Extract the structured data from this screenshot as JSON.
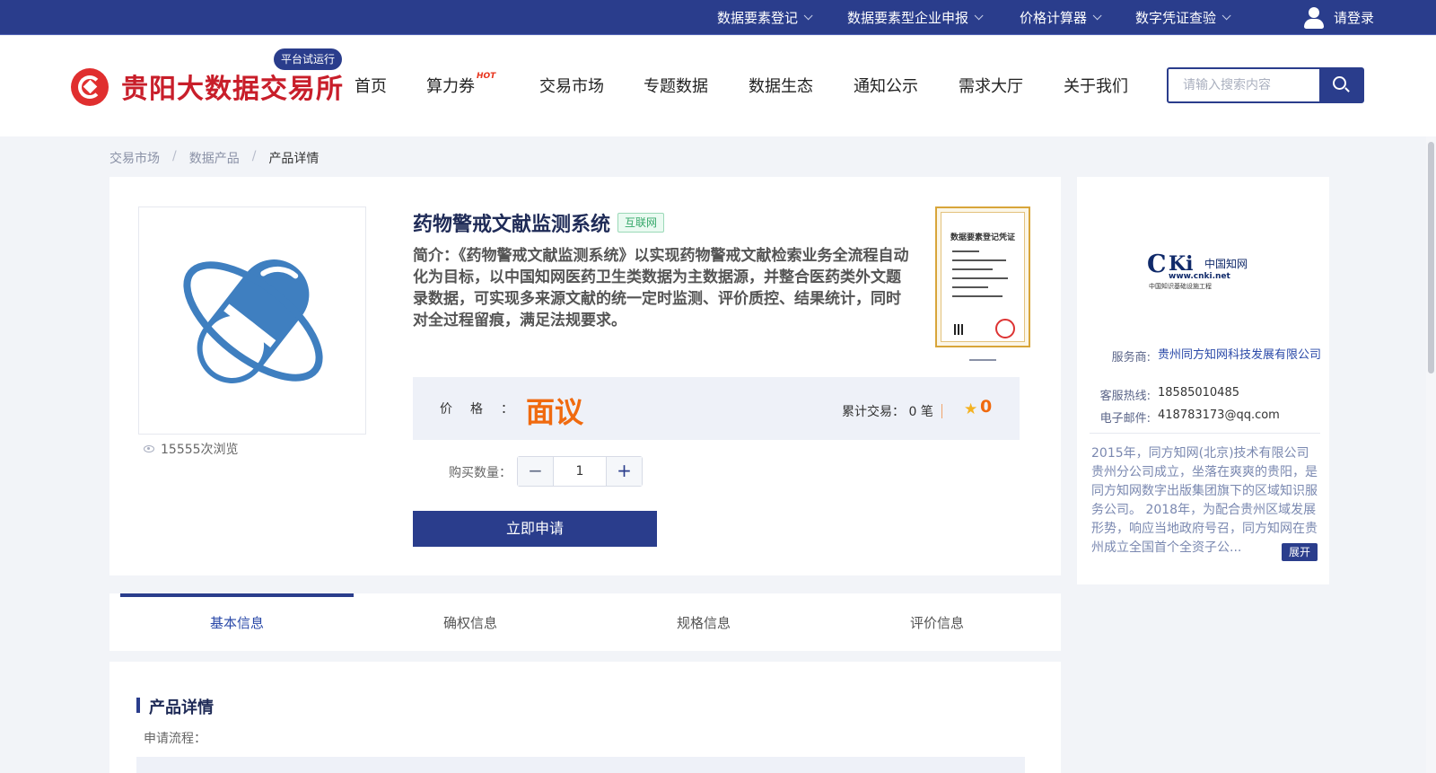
{
  "topbar": {
    "menus": [
      "数据要素登记",
      "数据要素型企业申报",
      "价格计算器",
      "数字凭证查验"
    ],
    "login_label": "请登录"
  },
  "header": {
    "logo_text": "贵阳大数据交易所",
    "trial_badge": "平台试运行",
    "nav": [
      "首页",
      "算力券",
      "交易市场",
      "专题数据",
      "数据生态",
      "通知公示",
      "需求大厅",
      "关于我们"
    ],
    "hot_tag": "HOT",
    "search_placeholder": "请输入搜索内容"
  },
  "breadcrumb": [
    "交易市场",
    "数据产品",
    "产品详情"
  ],
  "product": {
    "title": "药物警戒文献监测系统",
    "tag": "互联网",
    "intro": "简介：《药物警戒文献监测系统》以实现药物警戒文献检索业务全流程自动化为目标，以中国知网医药卫生类数据为主数据源，并整合医药类外文题录数据，可实现多来源文献的统一定时监测、评价质控、结果统计，同时对全过程留痕，满足法规要求。",
    "views": "15555次浏览",
    "cert_title": "数据要素登记凭证",
    "price_label": "价格",
    "price_colon": "：",
    "price_value": "面议",
    "trade_label": "累计交易：",
    "trade_count": "0",
    "trade_unit": "笔",
    "rating": "0",
    "qty_label": "购买数量：",
    "qty_minus": "−",
    "qty_value": "1",
    "qty_plus": "+",
    "apply_label": "立即申请"
  },
  "provider": {
    "logo_c": "C",
    "logo_ki": "Ki",
    "logo_cn": "中国知网",
    "logo_url": "www.cnki.net",
    "logo_sub": "中国知识基础设施工程",
    "service_key": "服务商:",
    "service_val": "贵州同方知网科技发展有限公司",
    "hotline_key": "客服热线:",
    "hotline_val": "18585010485",
    "email_key": "电子邮件:",
    "email_val": "418783173@qq.com",
    "description": "2015年，同方知网(北京)技术有限公司贵州分公司成立，坐落在爽爽的贵阳，是同方知网数字出版集团旗下的区域知识服务公司。 2018年，为配合贵州区域发展形势，响应当地政府号召，同方知网在贵州成立全国首个全资子公...",
    "expand_label": "展开"
  },
  "tabs": [
    "基本信息",
    "确权信息",
    "规格信息",
    "评价信息"
  ],
  "details": {
    "title": "产品详情",
    "sub": "申请流程："
  },
  "colors": {
    "brand_blue": "#2a3d8c",
    "logo_red": "#c81e2a",
    "price_orange": "#f06a0f",
    "pill_blue": "#3f7fc0"
  }
}
